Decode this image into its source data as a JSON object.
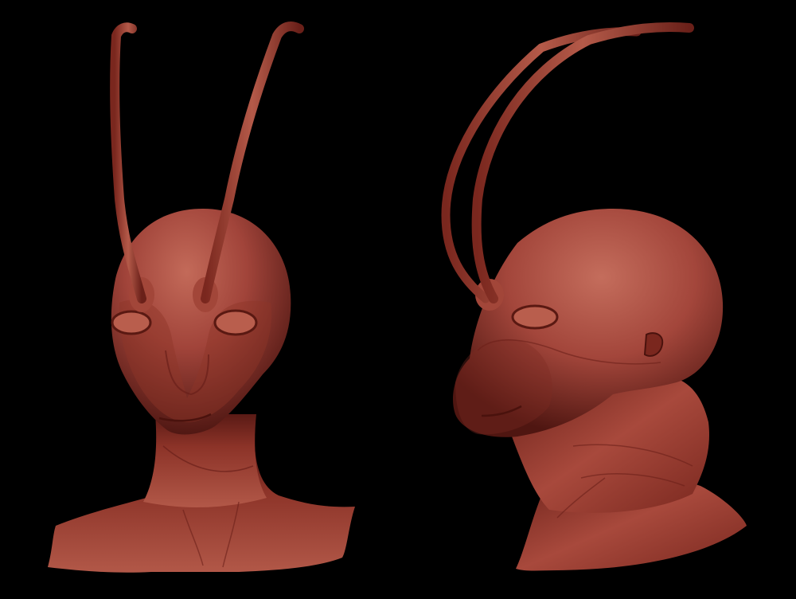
{
  "scene": {
    "background_color": "#000000",
    "skin_color": "#9a3a30",
    "skin_highlight": "#c46a58",
    "skin_shadow": "#3a0f0c",
    "views": [
      {
        "id": "front-view",
        "label": ""
      },
      {
        "id": "side-view",
        "label": ""
      }
    ]
  }
}
